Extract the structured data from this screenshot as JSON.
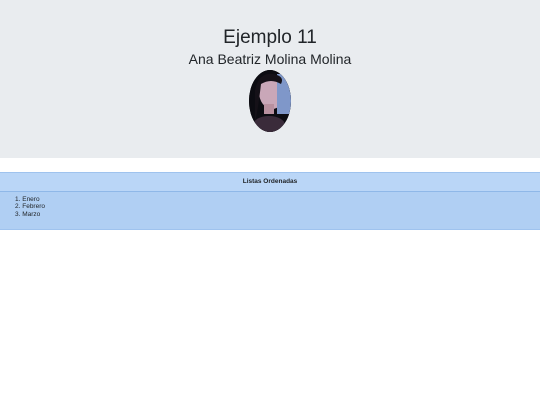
{
  "header": {
    "title": "Ejemplo 11",
    "subtitle": "Ana Beatriz Molina Molina"
  },
  "card": {
    "heading": "Listas Ordenadas",
    "items": [
      {
        "number": "1.",
        "label": "Enero"
      },
      {
        "number": "2.",
        "label": "Febrero"
      },
      {
        "number": "3.",
        "label": "Marzo"
      }
    ]
  },
  "colors": {
    "header_bg": "#e9ecef",
    "card_bg": "#b0cff3",
    "card_header_bg": "#bad6f7"
  }
}
